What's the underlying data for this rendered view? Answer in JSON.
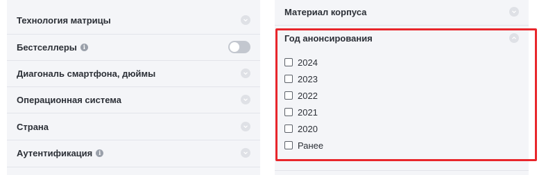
{
  "left_filters": [
    {
      "label": "Технология матрицы",
      "control": "chevron"
    },
    {
      "label": "Бестселлеры",
      "control": "toggle",
      "info": true,
      "toggle_on": false
    },
    {
      "label": "Диагональ смартфона, дюймы",
      "control": "chevron"
    },
    {
      "label": "Операционная система",
      "control": "chevron"
    },
    {
      "label": "Страна",
      "control": "chevron"
    },
    {
      "label": "Аутентификация",
      "control": "chevron",
      "info": true
    }
  ],
  "right_filters": {
    "material": {
      "label": "Материал корпуса"
    },
    "year": {
      "label": "Год анонсирования",
      "expanded": true,
      "options": [
        {
          "label": "2024",
          "checked": false
        },
        {
          "label": "2023",
          "checked": false
        },
        {
          "label": "2022",
          "checked": false
        },
        {
          "label": "2021",
          "checked": false
        },
        {
          "label": "2020",
          "checked": false
        },
        {
          "label": "Ранее",
          "checked": false
        }
      ]
    }
  },
  "colors": {
    "highlight": "#e8262b",
    "panel_bg": "#f4f5f8",
    "text": "#2b2f36"
  },
  "icons": {
    "info": "i",
    "chevron": "chevron-down-icon"
  }
}
